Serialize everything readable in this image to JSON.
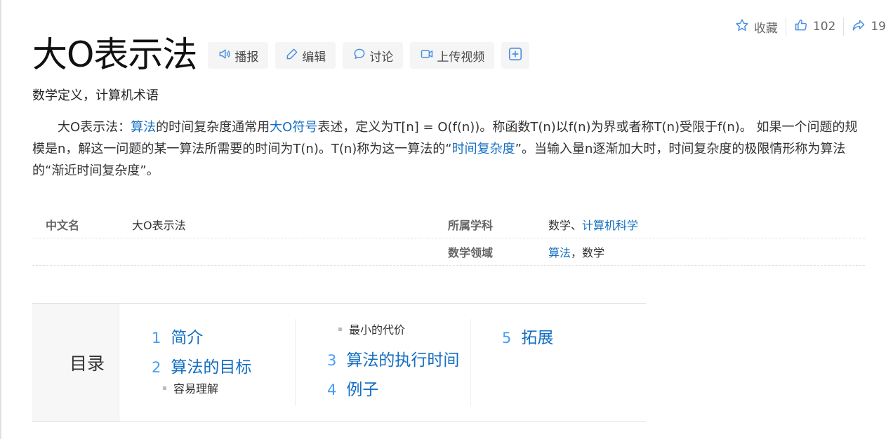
{
  "stats": {
    "collect_label": "收藏",
    "like_count": "102",
    "share_count": "19"
  },
  "title": "大O表示法",
  "tools": {
    "broadcast": "播报",
    "edit": "编辑",
    "discuss": "讨论",
    "upload_video": "上传视频"
  },
  "subtitle": "数学定义，计算机术语",
  "summary": {
    "t1": "大O表示法：",
    "l1": "算法",
    "t2": "的时间复杂度通常用",
    "l2": "大O符号",
    "t3": "表述，定义为T[n] = O(f(n))。称函数T(n)以f(n)为界或者称T(n)受限于f(n)。 如果一个问题的规模是n，解这一问题的某一算法所需要的时间为T(n)。T(n)称为这一算法的“",
    "l3": "时间复杂度",
    "t4": "”。当输入量n逐渐加大时，时间复杂度的极限情形称为算法的“渐近时间复杂度”。"
  },
  "info": {
    "name_label": "中文名",
    "name_value": "大O表示法",
    "subject_label": "所属学科",
    "subject_text": "数学、",
    "subject_link": "计算机科学",
    "field_label": "数学领域",
    "field_link": "算法",
    "field_text": "，数学"
  },
  "catalog": {
    "label": "目录",
    "items": [
      {
        "num": "1",
        "label": "简介"
      },
      {
        "num": "2",
        "label": "算法的目标"
      },
      {
        "num": "3",
        "label": "算法的执行时间"
      },
      {
        "num": "4",
        "label": "例子"
      },
      {
        "num": "5",
        "label": "拓展"
      }
    ],
    "subs": [
      "容易理解",
      "最小的代价"
    ]
  },
  "colors": {
    "link": "#136ec2",
    "catalog_number": "#459df5",
    "icon": "#4a90e2"
  }
}
